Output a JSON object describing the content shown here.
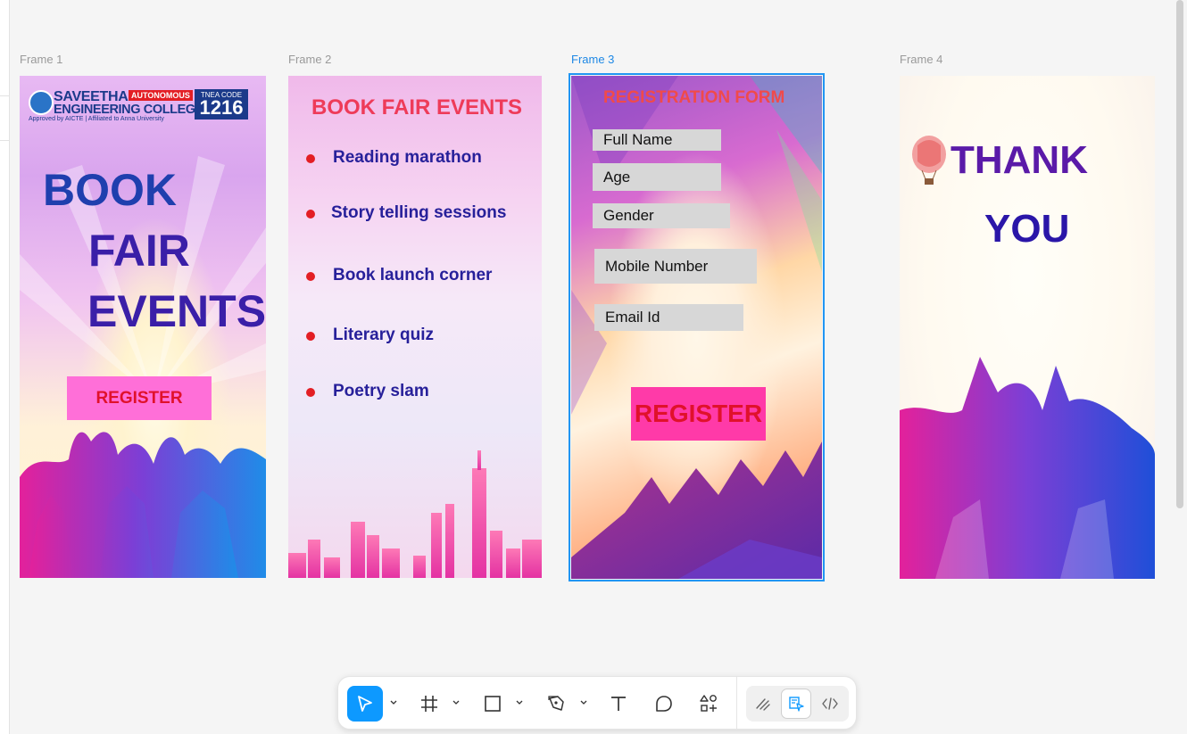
{
  "colors": {
    "canvas": "#f5f5f5",
    "selection": "#2196f3",
    "tool_active": "#0d99ff",
    "heading_blue": "#1f3fae",
    "heading_purple": "#3a1fa8",
    "register_pink": "#ff6fd8",
    "register_text": "#e0112b",
    "bullet_red": "#e31e24",
    "list_text": "#27209a"
  },
  "frames": [
    {
      "label": "Frame 1",
      "selected": false
    },
    {
      "label": "Frame 2",
      "selected": false
    },
    {
      "label": "Frame 3",
      "selected": true
    },
    {
      "label": "Frame 4",
      "selected": false
    }
  ],
  "frame1": {
    "logo": {
      "name": "SAVEETHA",
      "autonomous": "AUTONOMOUS",
      "college": "ENGINEERING COLLEGE",
      "approved": "Approved by AICTE | Affiliated to Anna University",
      "tnea_label": "TNEA CODE",
      "tnea_code": "1216"
    },
    "headline": [
      "BOOK",
      "FAIR",
      "EVENTS"
    ],
    "register_label": "REGISTER"
  },
  "frame2": {
    "title": "BOOK FAIR EVENTS",
    "events": [
      "Reading marathon",
      "Story telling sessions",
      "Book launch corner",
      "Literary quiz",
      "Poetry slam"
    ]
  },
  "frame3": {
    "title": "REGISTRATION FORM",
    "fields": [
      "Full Name",
      "Age",
      "Gender",
      "Mobile Number",
      "Email Id"
    ],
    "register_label": "REGISTER"
  },
  "frame4": {
    "line1": "THANK",
    "line2": "YOU"
  },
  "toolbar": {
    "tools": [
      "move-tool",
      "frame-tool",
      "shape-tool",
      "pen-tool",
      "text-tool",
      "comment-tool",
      "actions-tool"
    ],
    "active_tool": "move-tool",
    "modes": [
      "draw-mode",
      "design-mode",
      "dev-mode"
    ],
    "active_mode": "design-mode"
  }
}
